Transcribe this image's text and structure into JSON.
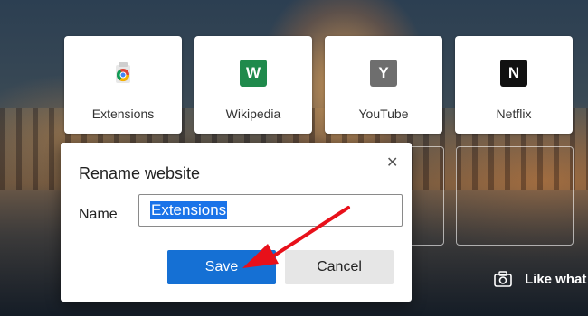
{
  "tiles": [
    {
      "label": "Extensions",
      "icon": "chrome-extensions-icon"
    },
    {
      "label": "Wikipedia",
      "icon_letter": "W",
      "icon_color": "#1f8a4c"
    },
    {
      "label": "YouTube",
      "icon_letter": "Y",
      "icon_color": "#6e6e6e"
    },
    {
      "label": "Netflix",
      "icon_letter": "N",
      "icon_color": "#111111"
    }
  ],
  "dialog": {
    "title": "Rename website",
    "name_label": "Name",
    "name_value": "Extensions",
    "save_label": "Save",
    "cancel_label": "Cancel",
    "close_glyph": "✕"
  },
  "background": {
    "feedback_text": "Like what"
  },
  "colors": {
    "accent": "#1570d4",
    "annotation_arrow": "#e8101a"
  }
}
